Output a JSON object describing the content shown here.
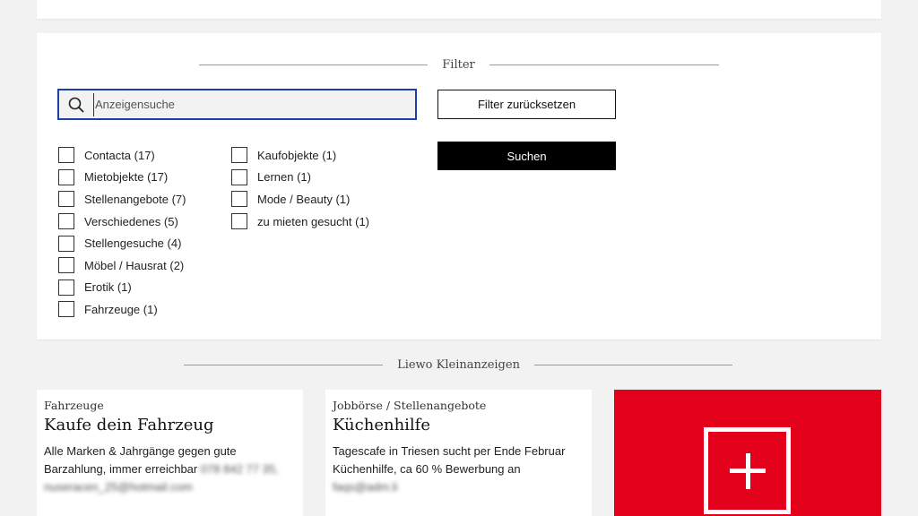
{
  "filter": {
    "heading": "Filter",
    "search_placeholder": "Anzeigensuche",
    "reset_label": "Filter zurücksetzen",
    "search_label": "Suchen",
    "categories_col1": [
      "Contacta (17)",
      "Mietobjekte (17)",
      "Stellenangebote (7)",
      "Verschiedenes (5)",
      "Stellengesuche (4)",
      "Möbel / Hausrat (2)",
      "Erotik (1)",
      "Fahrzeuge (1)"
    ],
    "categories_col2": [
      "Kaufobjekte (1)",
      "Lernen (1)",
      "Mode / Beauty (1)",
      "zu mieten gesucht (1)"
    ]
  },
  "listings": {
    "heading": "Liewo Kleinanzeigen",
    "ads": [
      {
        "category": "Fahrzeuge",
        "title": "Kaufe dein Fahrzeug",
        "text": "Alle Marken & Jahrgänge gegen gute Barzahlung, immer erreichbar",
        "contact_blurred": "078 842 77 35,",
        "email_blurred": "nuseracen_25@hotmail.com"
      },
      {
        "category": "Jobbörse / Stellenangebote",
        "title": "Küchenhilfe",
        "text": "Tagescafe in Triesen sucht per Ende Februar Küchenhilfe, ca 60 % Bewerbung an",
        "email_blurred": "faqs@adm.li"
      }
    ],
    "add_icon": "plus-icon"
  },
  "colors": {
    "accent_red": "#e2001a",
    "focus_blue": "#1a3fa6",
    "button_black": "#000000"
  }
}
